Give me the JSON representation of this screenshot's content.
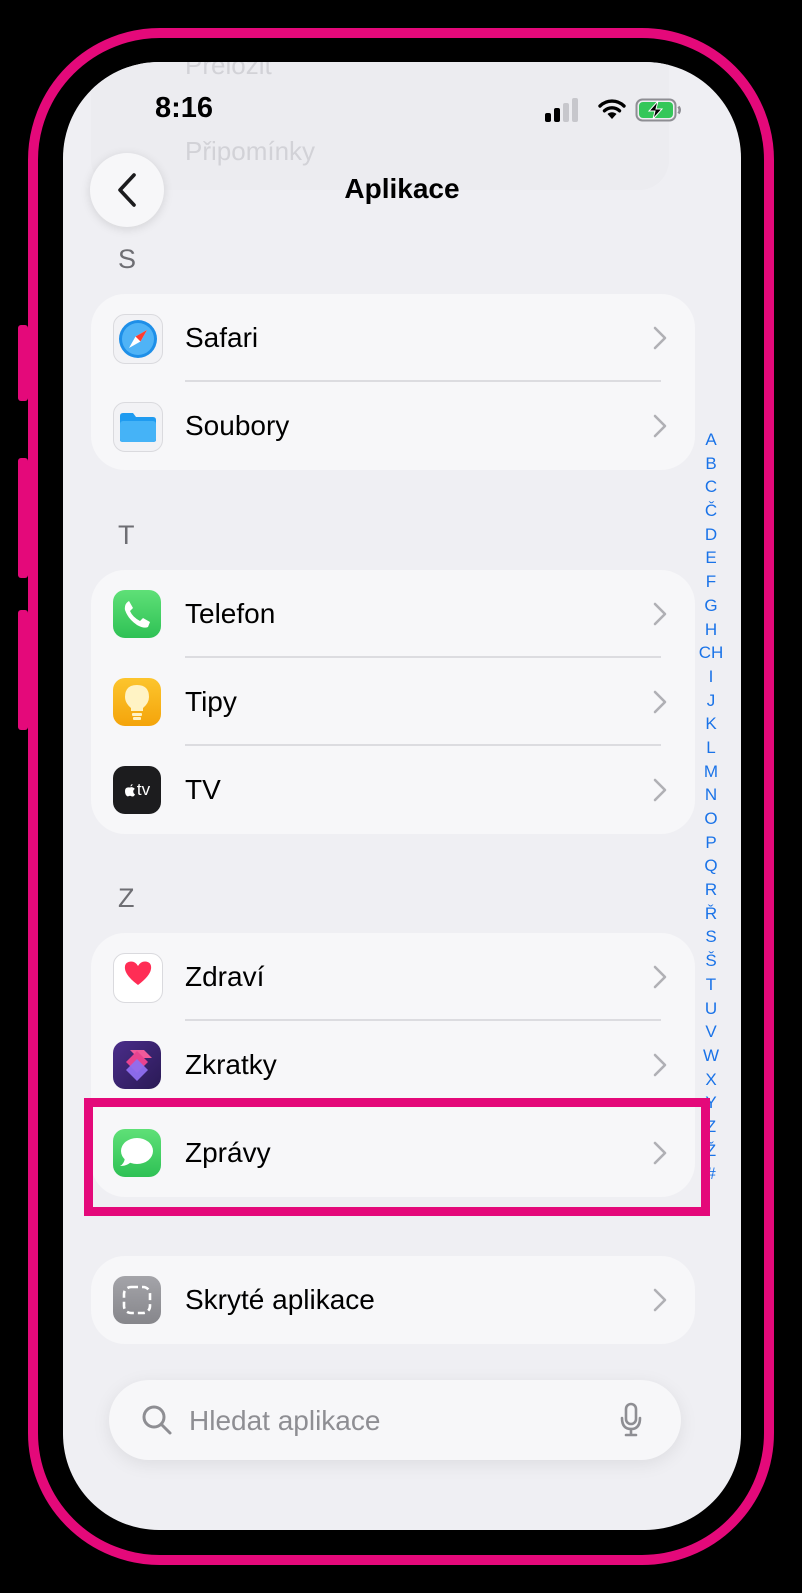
{
  "status_bar": {
    "time": "8:16"
  },
  "background_ghost": {
    "items": [
      "Přeložit",
      "Připomínky"
    ]
  },
  "nav": {
    "title": "Aplikace"
  },
  "sections": [
    {
      "letter": "S",
      "items": [
        {
          "label": "Safari",
          "icon": "safari-icon"
        },
        {
          "label": "Soubory",
          "icon": "files-folder-icon"
        }
      ]
    },
    {
      "letter": "T",
      "items": [
        {
          "label": "Telefon",
          "icon": "phone-icon"
        },
        {
          "label": "Tipy",
          "icon": "tips-lightbulb-icon"
        },
        {
          "label": "TV",
          "icon": "apple-tv-icon",
          "icon_text": "tv"
        }
      ]
    },
    {
      "letter": "Z",
      "items": [
        {
          "label": "Zdraví",
          "icon": "health-heart-icon"
        },
        {
          "label": "Zkratky",
          "icon": "shortcuts-icon"
        },
        {
          "label": "Zprávy",
          "icon": "messages-icon"
        }
      ]
    }
  ],
  "hidden_apps": {
    "label": "Skryté aplikace",
    "icon": "hidden-apps-icon"
  },
  "index_letters": [
    "A",
    "B",
    "C",
    "Č",
    "D",
    "E",
    "F",
    "G",
    "H",
    "CH",
    "I",
    "J",
    "K",
    "L",
    "M",
    "N",
    "O",
    "P",
    "Q",
    "R",
    "Ř",
    "S",
    "Š",
    "T",
    "U",
    "V",
    "W",
    "X",
    "Y",
    "Z",
    "Ž",
    "#"
  ],
  "search": {
    "placeholder": "Hledat aplikace",
    "value": ""
  },
  "colors": {
    "highlight": "#e4097a",
    "index": "#1a73e8",
    "background": "#efeff3"
  }
}
